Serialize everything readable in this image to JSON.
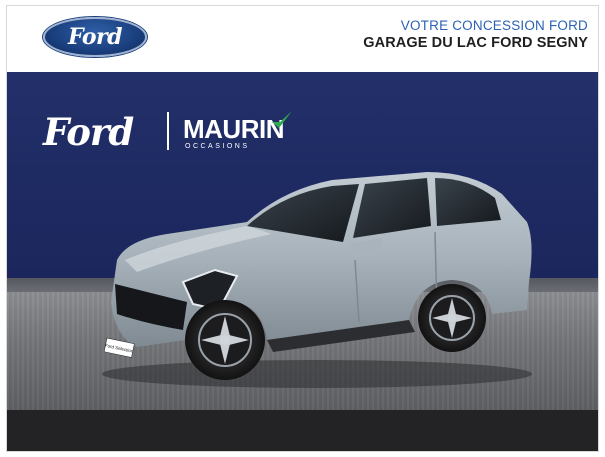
{
  "header": {
    "brand_logo_text": "Ford",
    "dealer_subtitle": "VOTRE CONCESSION FORD",
    "dealer_name": "GARAGE DU LAC FORD SEGNY"
  },
  "photo": {
    "ford_script_text": "Ford",
    "partner_name": "MAURIN",
    "partner_subtitle": "OCCASIONS",
    "plate_text": "Ford Sélection"
  },
  "colors": {
    "ford_blue": "#1a3f7e",
    "accent_blue": "#2b62b5",
    "wall_blue": "#1e2a62",
    "car_silver": "#a8b3bc"
  }
}
